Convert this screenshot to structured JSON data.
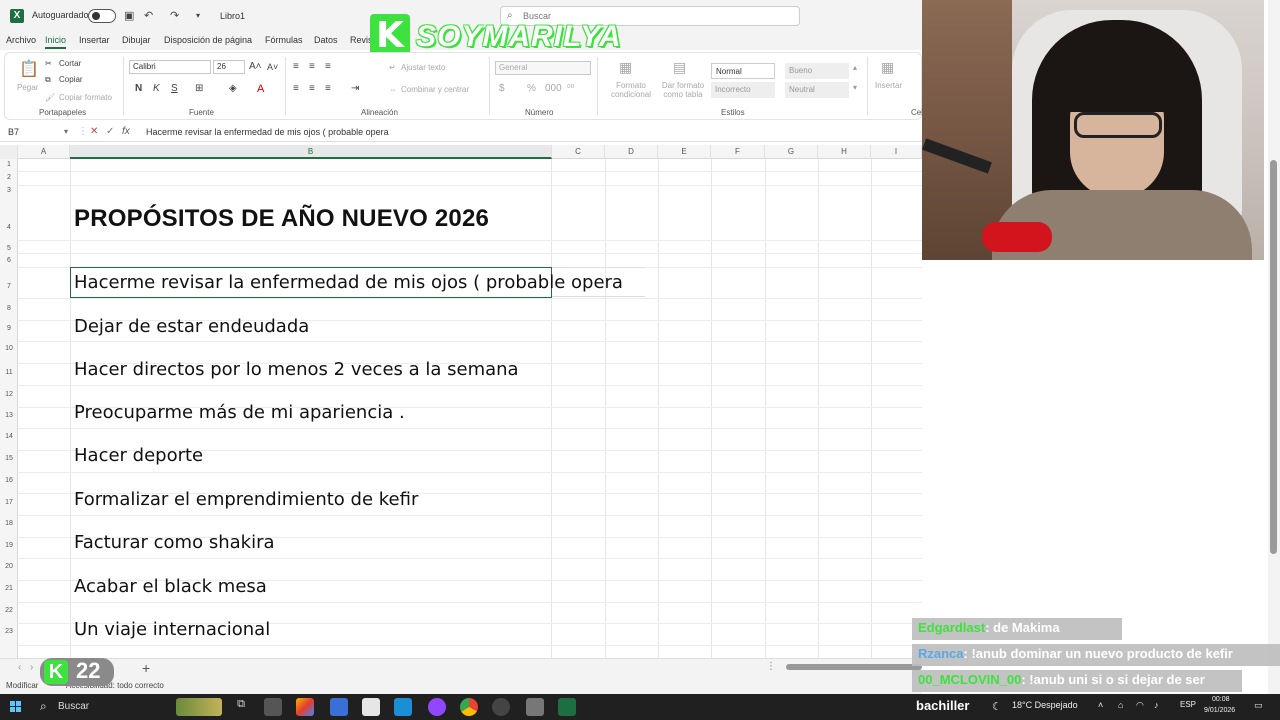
{
  "titlebar": {
    "autosave_label": "Autoguardado",
    "doc_name": "Libro1",
    "search_placeholder": "Buscar"
  },
  "watermark": {
    "k": "K",
    "text": "SOYMARILYA"
  },
  "menu": {
    "tabs": [
      "Archivo",
      "Inicio",
      "Insertar",
      "Dibujar",
      "Disposición de página",
      "Fórmulas",
      "Datos",
      "Revis"
    ]
  },
  "ribbon": {
    "clipboard": {
      "paste": "Pegar",
      "cut": "Cortar",
      "copy": "Copiar",
      "format_painter": "Copiar formato",
      "group": "Portapapeles"
    },
    "font": {
      "name": "Calibri",
      "size": "26",
      "group": "Fuente",
      "bold": "N",
      "italic": "K",
      "underline": "S"
    },
    "alignment": {
      "wrap": "Ajustar texto",
      "merge": "Combinar y centrar",
      "group": "Alineación"
    },
    "number": {
      "format": "General",
      "group": "Número",
      "percent": "%"
    },
    "styles": {
      "cond_format": "Formato condicional",
      "as_table": "Dar formato como tabla",
      "normal": "Normal",
      "bueno": "Bueno",
      "incorrecto": "Incorrecto",
      "neutral": "Neutral",
      "group": "Estilos"
    },
    "cells": {
      "insert": "Insertar",
      "group": "Cel"
    }
  },
  "formula_bar": {
    "name_box": "B7",
    "fx": "fx",
    "content": "Hacerme revisar la enfermedad de mis ojos ( probable opera"
  },
  "grid": {
    "columns": [
      "A",
      "B",
      "C",
      "D",
      "E",
      "F",
      "G",
      "H",
      "I"
    ],
    "rows": [
      "1",
      "2",
      "3",
      "4",
      "5",
      "6",
      "7",
      "8",
      "9",
      "10",
      "11",
      "12",
      "13",
      "14",
      "15",
      "16",
      "17",
      "18",
      "19",
      "20",
      "21",
      "22",
      "23"
    ],
    "title": "PROPÓSITOS DE AÑO NUEVO 2026",
    "items": [
      "Hacerme revisar la enfermedad de mis ojos ( probable opera",
      "Dejar de estar endeudada",
      "Hacer directos por lo menos  2 veces a la semana",
      "Preocuparme más de mi apariencia .",
      "Hacer deporte",
      "Formalizar el emprendimiento de kefir",
      "Facturar como shakira",
      "Acabar el black mesa",
      "Un viaje internacional"
    ]
  },
  "sheetbar": {
    "add": "+"
  },
  "badge": {
    "k": "K",
    "number": "22"
  },
  "statusbar": {
    "mode": "Modificar",
    "accessibility": "Accesibilidad: todo correcto"
  },
  "chat": [
    {
      "user": "Edgardlast",
      "message": ": de Makima"
    },
    {
      "user": "Rzanca",
      "message": ": !anub dominar un nuevo producto de kefir"
    },
    {
      "user": "00_MCLOVIN_00",
      "message": ": !anub uni si o si dejar de ser"
    }
  ],
  "taskbar": {
    "search": "Buscar",
    "streamer": "bachiller",
    "weather": "18°C  Despejado",
    "lang": "ESP",
    "time": "00:08",
    "date": "9/01/2026"
  },
  "colors": {
    "excel_green": "#1d6f42",
    "watermark_green": "#3ee23e",
    "taskbar": "#202020"
  }
}
